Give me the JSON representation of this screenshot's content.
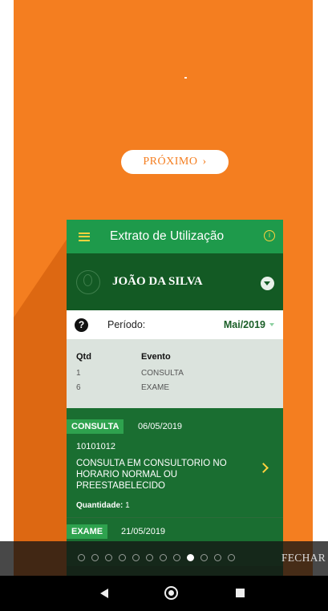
{
  "colors": {
    "background": "#f47e20",
    "card_header": "#1e9a4b",
    "card_body": "#1a5e27",
    "accent": "#ffd23e",
    "tag": "#2ea24e"
  },
  "tutorial": {
    "next_label": "PRÓXIMO",
    "close_label": "FECHAR",
    "page_count": 12,
    "current_page": 9
  },
  "app": {
    "title": "Extrato de Utilização",
    "user_name": "JOÃO DA SILVA",
    "period_label": "Período:",
    "period_value": "Mai/2019",
    "summary": {
      "headers": [
        "Qtd",
        "Evento"
      ],
      "rows": [
        {
          "qtd": "1",
          "evento": "CONSULTA"
        },
        {
          "qtd": "6",
          "evento": "EXAME"
        }
      ]
    },
    "events": [
      {
        "type": "CONSULTA",
        "date": "06/05/2019",
        "code": "10101012",
        "description": "CONSULTA EM CONSULTORIO NO HORARIO NORMAL OU PREESTABELECIDO",
        "quantity_label": "Quantidade:",
        "quantity": "1"
      },
      {
        "type": "EXAME",
        "date": "21/05/2019"
      }
    ]
  },
  "icons": {
    "menu": "hamburger-menu-icon",
    "info": "info-icon",
    "avatar": "user-avatar-icon",
    "expand": "chevron-down-circle-icon",
    "help": "question-circle-icon",
    "period_dropdown": "caret-down-icon",
    "event_open": "chevron-right-icon",
    "next": "chevron-right-icon",
    "nav_back": "back-triangle-icon",
    "nav_home": "home-circle-icon",
    "nav_recent": "recent-apps-square-icon"
  }
}
